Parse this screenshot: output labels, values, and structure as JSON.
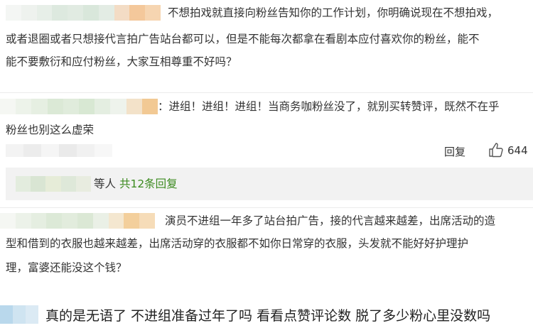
{
  "comment1": {
    "lines": [
      "不想拍戏就直接向粉丝告知你的工作计划，你明确说现在不想拍戏，",
      "或者退圈或者只想接代言拍广告站台都可以，但是不能每次都拿在看剧本应付喜欢你的粉丝，能不",
      "能不要敷衍和应付粉丝，大家互相尊重不好吗？"
    ]
  },
  "comment2": {
    "lines": [
      "：进组！进组！进组！当商务咖粉丝没了，就别买转赞评，既然不在乎",
      "粉丝也别这么虚荣"
    ],
    "reply_label": "回复",
    "like_count": "644"
  },
  "reply_summary": {
    "prefix": "等人",
    "link": "共12条回复"
  },
  "comment3": {
    "lines": [
      "演员不进组一年多了站台拍广告，接的代言越来越差，出席活动的造",
      "型和借到的衣服也越来越差，出席活动穿的衣服都不如你日常穿的衣服，头发就不能好好护理护",
      "理，富婆还能没这个钱？"
    ]
  },
  "comment4": {
    "text": "真的是无语了 不进组准备过年了吗 看看点赞评论数 脱了多少粉心里没数吗"
  },
  "icons": {
    "like": "thumbs-up-icon"
  }
}
